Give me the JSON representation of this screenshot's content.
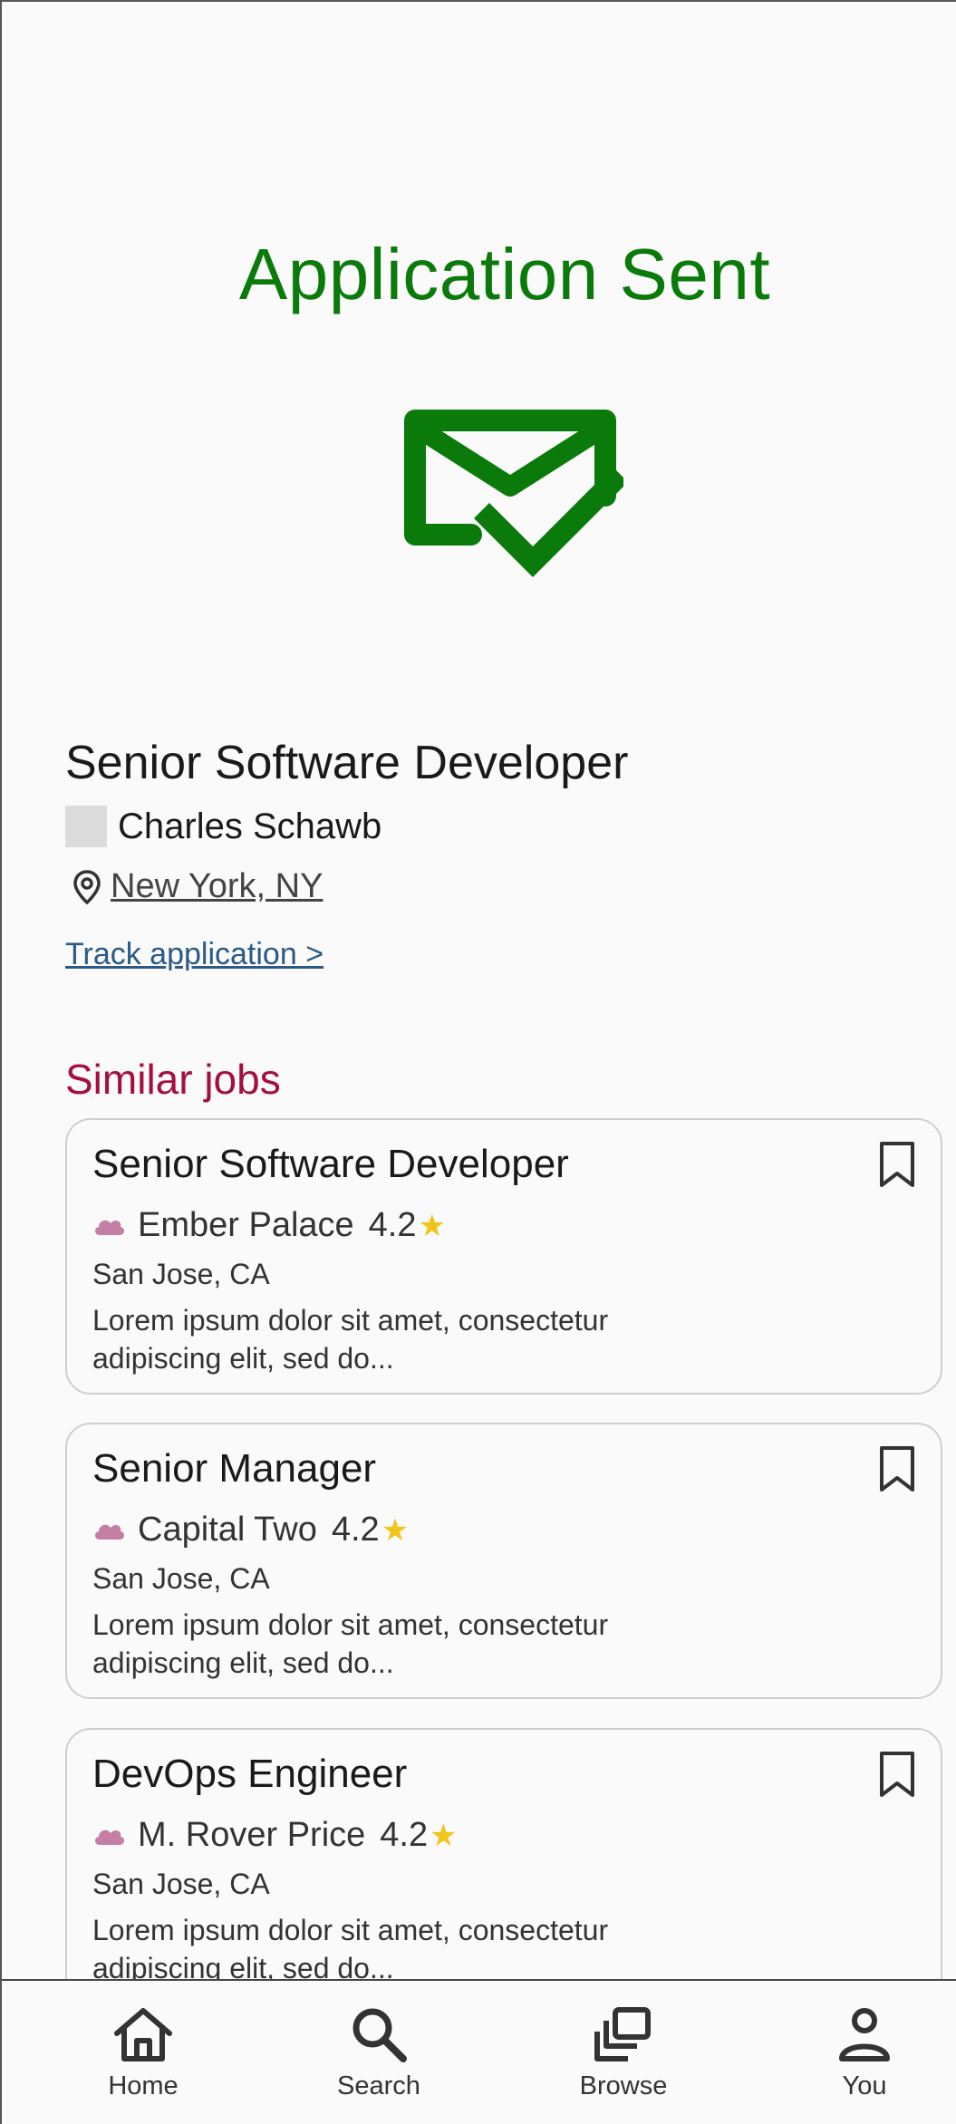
{
  "header": {
    "title": "Application Sent"
  },
  "icons": {
    "hero": "mail-check-icon",
    "location": "location-pin-icon",
    "bookmark": "bookmark-icon",
    "company": "cloud-icon",
    "star": "star-icon"
  },
  "colors": {
    "success": "#0a7a0a",
    "accent": "#a3103e",
    "link": "#2a5a85",
    "star": "#f0c419",
    "logo": "#c57ea4"
  },
  "application": {
    "job_title": "Senior Software Developer",
    "company": "Charles Schawb",
    "location": "New York, NY",
    "track_link": "Track application >"
  },
  "similar": {
    "heading": "Similar jobs",
    "jobs": [
      {
        "title": "Senior Software Developer",
        "company": "Ember Palace",
        "rating": "4.2",
        "location": "San Jose, CA",
        "description": "Lorem ipsum dolor sit amet, consectetur adipiscing elit, sed do..."
      },
      {
        "title": "Senior Manager",
        "company": "Capital Two",
        "rating": "4.2",
        "location": "San Jose, CA",
        "description": "Lorem ipsum dolor sit amet, consectetur adipiscing elit, sed do..."
      },
      {
        "title": "DevOps Engineer",
        "company": "M. Rover Price",
        "rating": "4.2",
        "location": "San Jose, CA",
        "description": "Lorem ipsum dolor sit amet, consectetur adipiscing elit, sed do..."
      }
    ]
  },
  "nav": {
    "items": [
      {
        "label": "Home",
        "icon": "home-icon"
      },
      {
        "label": "Search",
        "icon": "search-icon"
      },
      {
        "label": "Browse",
        "icon": "browse-icon"
      },
      {
        "label": "You",
        "icon": "person-icon"
      }
    ]
  }
}
